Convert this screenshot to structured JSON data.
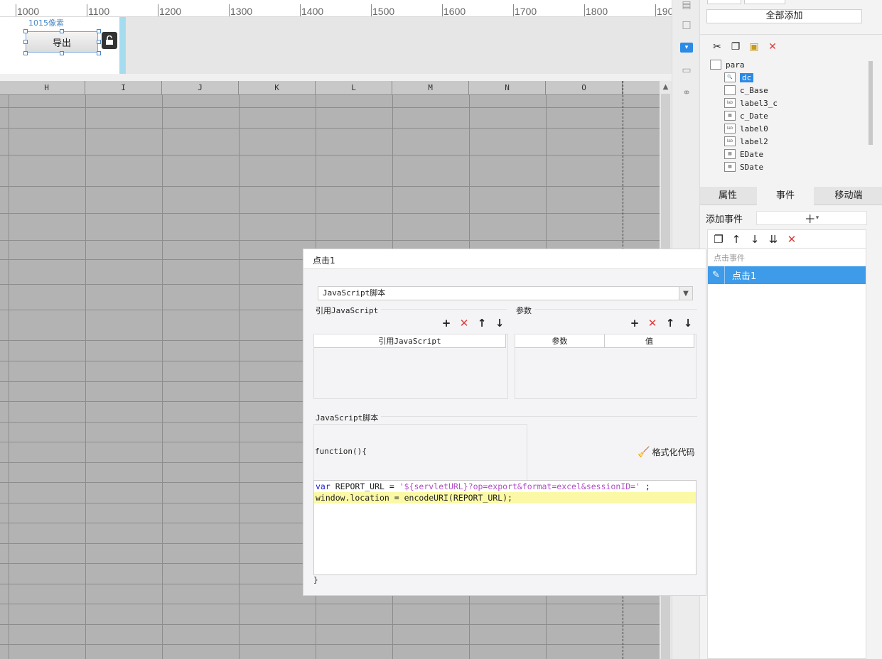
{
  "ruler": {
    "labels": [
      "1000",
      "1100",
      "1200",
      "1300",
      "1400",
      "1500",
      "1600",
      "1700",
      "1800",
      "190"
    ]
  },
  "param": {
    "pixel_label": "1015像素",
    "export_button": "导出"
  },
  "sheet": {
    "columns": [
      "H",
      "I",
      "J",
      "K",
      "L",
      "M",
      "N",
      "O"
    ]
  },
  "right_panel": {
    "add_all": "全部添加",
    "tree": {
      "root": "para",
      "items": [
        "dc",
        "c_Base",
        "label3_c",
        "c_Date",
        "label0",
        "label2",
        "EDate",
        "SDate"
      ]
    },
    "tabs": [
      "属性",
      "事件",
      "移动端"
    ],
    "add_event_label": "添加事件",
    "event_group": "点击事件",
    "event_item": "点击1"
  },
  "dialog": {
    "title": "点击1",
    "script_type": "JavaScript脚本",
    "ref_js_title": "引用JavaScript",
    "params_title": "参数",
    "ref_js_header": "引用JavaScript",
    "param_header": "参数",
    "value_header": "值",
    "js_section_title": "JavaScript脚本",
    "function_head": "function(){",
    "format_code": "格式化代码",
    "code": {
      "line1_kw": "var",
      "line1_a": " REPORT_URL = ",
      "line1_str": "'${servletURL}?op=export&format=excel&sessionID='",
      "line1_b": " ;",
      "line2": "window.location = encodeURI(REPORT_URL);"
    },
    "closing_brace": "}"
  },
  "colors": {
    "accent": "#2b8ae6",
    "selected_event": "#3d9be9",
    "delete_red": "#e03c3c",
    "highlight_line": "#fcf9a6"
  }
}
